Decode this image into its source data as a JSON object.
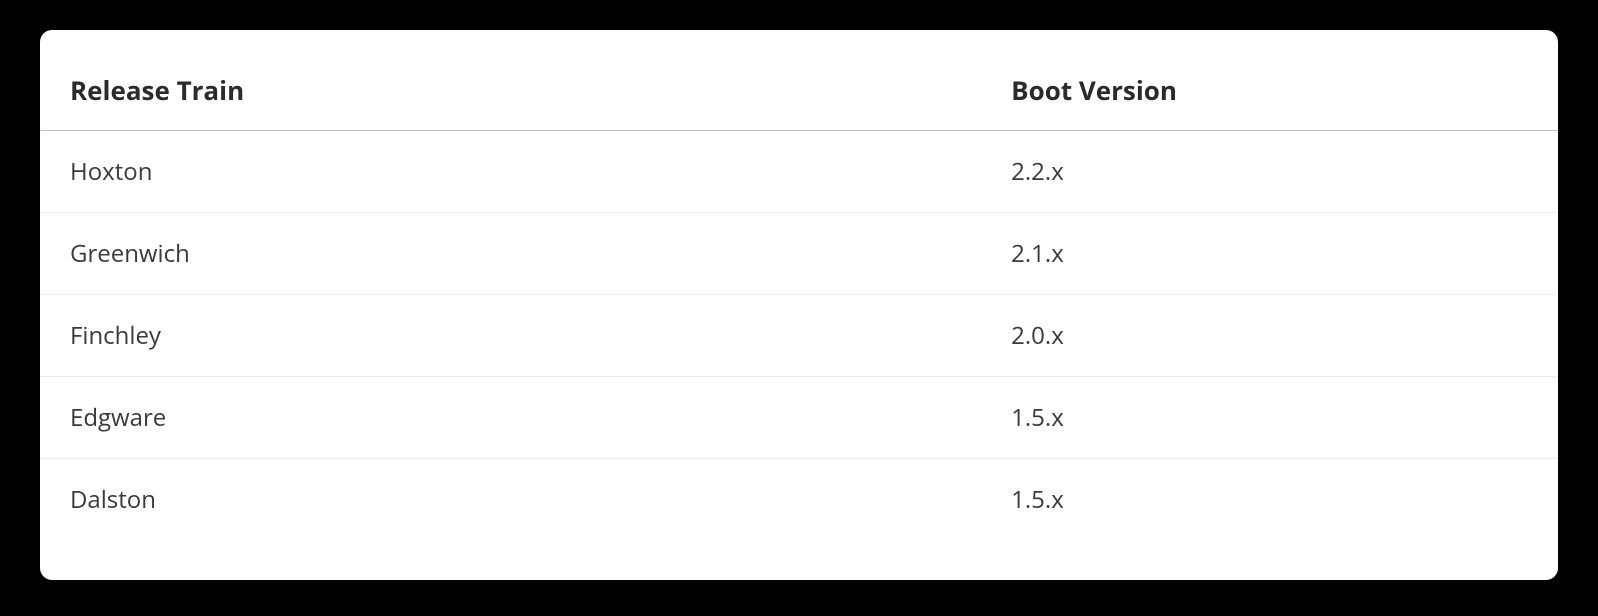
{
  "table": {
    "headers": {
      "release_train": "Release Train",
      "boot_version": "Boot Version"
    },
    "rows": [
      {
        "release_train": "Hoxton",
        "boot_version": "2.2.x"
      },
      {
        "release_train": "Greenwich",
        "boot_version": "2.1.x"
      },
      {
        "release_train": "Finchley",
        "boot_version": "2.0.x"
      },
      {
        "release_train": "Edgware",
        "boot_version": "1.5.x"
      },
      {
        "release_train": "Dalston",
        "boot_version": "1.5.x"
      }
    ]
  }
}
